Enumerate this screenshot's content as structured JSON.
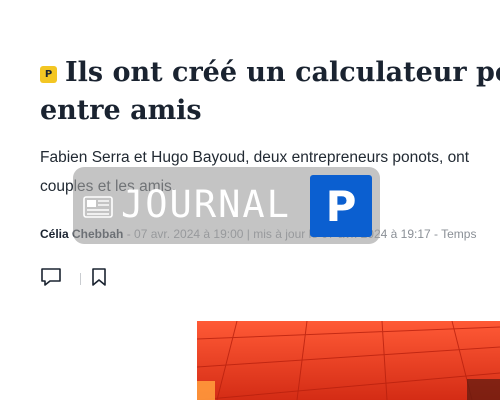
{
  "article": {
    "badge_letter": "P",
    "headline_line1": "Ils ont créé un calculateur pour",
    "headline_line2": "entre amis",
    "lead_line1": "Fabien Serra et Hugo Bayoud, deux entrepreneurs ponots, ont",
    "lead_line2": "couples et les amis.",
    "author": "Célia Chebbah",
    "published": " - 07 avr. 2024 à 19:00 | mis à jour le 07 avr. 2024 à 19:17 - Temps"
  },
  "actions": {
    "comment_icon": "comment-icon",
    "bookmark_icon": "bookmark-icon"
  },
  "overlay": {
    "label": "JOURNAL",
    "icon": "newspaper-icon",
    "logo_letter": "P"
  },
  "colors": {
    "badge": "#f3c623",
    "headline": "#1a2330",
    "logo_blue": "#0b5fd0",
    "photo_red": "#e8351c"
  }
}
